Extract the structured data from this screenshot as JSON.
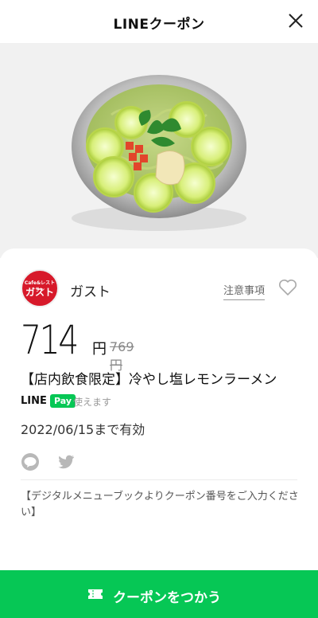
{
  "header": {
    "title": "LINEクーポン"
  },
  "store": {
    "logo_top": "Cafe&レストラン",
    "logo_name": "ガスト",
    "name": "ガスト"
  },
  "notes_link": "注意事項",
  "price": {
    "value": "714",
    "unit": "円",
    "original": "769円"
  },
  "coupon_title": "【店内飲食限定】冷やし塩レモンラーメン",
  "payment": {
    "line": "LINE",
    "pay": "Pay",
    "status": "使えます"
  },
  "validity": "2022/06/15まで有効",
  "note": "【デジタルメニューブックよりクーポン番号をご入力ください】",
  "button": {
    "label": "クーポンをつかう"
  },
  "colors": {
    "accent_green": "#06c755",
    "brand_red": "#d7192a"
  },
  "icons": {
    "close": "close-icon",
    "favorite": "heart-icon",
    "share_line": "line-share-icon",
    "share_twitter": "twitter-icon",
    "ticket": "ticket-icon"
  }
}
